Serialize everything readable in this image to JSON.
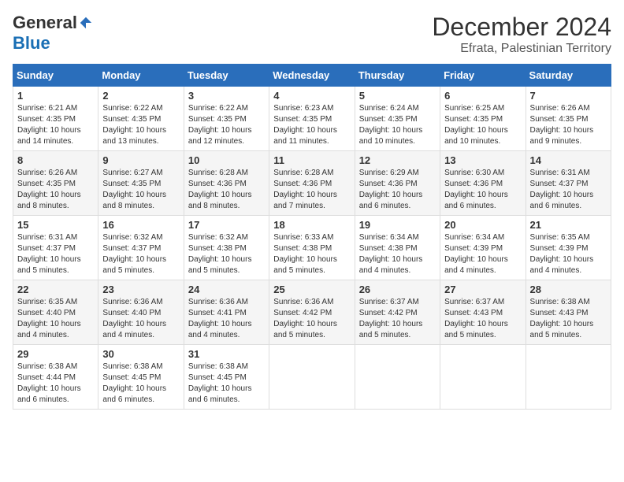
{
  "header": {
    "logo_general": "General",
    "logo_blue": "Blue",
    "month_title": "December 2024",
    "location": "Efrata, Palestinian Territory"
  },
  "weekdays": [
    "Sunday",
    "Monday",
    "Tuesday",
    "Wednesday",
    "Thursday",
    "Friday",
    "Saturday"
  ],
  "weeks": [
    [
      {
        "day": "1",
        "sunrise": "6:21 AM",
        "sunset": "4:35 PM",
        "daylight": "10 hours and 14 minutes."
      },
      {
        "day": "2",
        "sunrise": "6:22 AM",
        "sunset": "4:35 PM",
        "daylight": "10 hours and 13 minutes."
      },
      {
        "day": "3",
        "sunrise": "6:22 AM",
        "sunset": "4:35 PM",
        "daylight": "10 hours and 12 minutes."
      },
      {
        "day": "4",
        "sunrise": "6:23 AM",
        "sunset": "4:35 PM",
        "daylight": "10 hours and 11 minutes."
      },
      {
        "day": "5",
        "sunrise": "6:24 AM",
        "sunset": "4:35 PM",
        "daylight": "10 hours and 10 minutes."
      },
      {
        "day": "6",
        "sunrise": "6:25 AM",
        "sunset": "4:35 PM",
        "daylight": "10 hours and 10 minutes."
      },
      {
        "day": "7",
        "sunrise": "6:26 AM",
        "sunset": "4:35 PM",
        "daylight": "10 hours and 9 minutes."
      }
    ],
    [
      {
        "day": "8",
        "sunrise": "6:26 AM",
        "sunset": "4:35 PM",
        "daylight": "10 hours and 8 minutes."
      },
      {
        "day": "9",
        "sunrise": "6:27 AM",
        "sunset": "4:35 PM",
        "daylight": "10 hours and 8 minutes."
      },
      {
        "day": "10",
        "sunrise": "6:28 AM",
        "sunset": "4:36 PM",
        "daylight": "10 hours and 8 minutes."
      },
      {
        "day": "11",
        "sunrise": "6:28 AM",
        "sunset": "4:36 PM",
        "daylight": "10 hours and 7 minutes."
      },
      {
        "day": "12",
        "sunrise": "6:29 AM",
        "sunset": "4:36 PM",
        "daylight": "10 hours and 6 minutes."
      },
      {
        "day": "13",
        "sunrise": "6:30 AM",
        "sunset": "4:36 PM",
        "daylight": "10 hours and 6 minutes."
      },
      {
        "day": "14",
        "sunrise": "6:31 AM",
        "sunset": "4:37 PM",
        "daylight": "10 hours and 6 minutes."
      }
    ],
    [
      {
        "day": "15",
        "sunrise": "6:31 AM",
        "sunset": "4:37 PM",
        "daylight": "10 hours and 5 minutes."
      },
      {
        "day": "16",
        "sunrise": "6:32 AM",
        "sunset": "4:37 PM",
        "daylight": "10 hours and 5 minutes."
      },
      {
        "day": "17",
        "sunrise": "6:32 AM",
        "sunset": "4:38 PM",
        "daylight": "10 hours and 5 minutes."
      },
      {
        "day": "18",
        "sunrise": "6:33 AM",
        "sunset": "4:38 PM",
        "daylight": "10 hours and 5 minutes."
      },
      {
        "day": "19",
        "sunrise": "6:34 AM",
        "sunset": "4:38 PM",
        "daylight": "10 hours and 4 minutes."
      },
      {
        "day": "20",
        "sunrise": "6:34 AM",
        "sunset": "4:39 PM",
        "daylight": "10 hours and 4 minutes."
      },
      {
        "day": "21",
        "sunrise": "6:35 AM",
        "sunset": "4:39 PM",
        "daylight": "10 hours and 4 minutes."
      }
    ],
    [
      {
        "day": "22",
        "sunrise": "6:35 AM",
        "sunset": "4:40 PM",
        "daylight": "10 hours and 4 minutes."
      },
      {
        "day": "23",
        "sunrise": "6:36 AM",
        "sunset": "4:40 PM",
        "daylight": "10 hours and 4 minutes."
      },
      {
        "day": "24",
        "sunrise": "6:36 AM",
        "sunset": "4:41 PM",
        "daylight": "10 hours and 4 minutes."
      },
      {
        "day": "25",
        "sunrise": "6:36 AM",
        "sunset": "4:42 PM",
        "daylight": "10 hours and 5 minutes."
      },
      {
        "day": "26",
        "sunrise": "6:37 AM",
        "sunset": "4:42 PM",
        "daylight": "10 hours and 5 minutes."
      },
      {
        "day": "27",
        "sunrise": "6:37 AM",
        "sunset": "4:43 PM",
        "daylight": "10 hours and 5 minutes."
      },
      {
        "day": "28",
        "sunrise": "6:38 AM",
        "sunset": "4:43 PM",
        "daylight": "10 hours and 5 minutes."
      }
    ],
    [
      {
        "day": "29",
        "sunrise": "6:38 AM",
        "sunset": "4:44 PM",
        "daylight": "10 hours and 6 minutes."
      },
      {
        "day": "30",
        "sunrise": "6:38 AM",
        "sunset": "4:45 PM",
        "daylight": "10 hours and 6 minutes."
      },
      {
        "day": "31",
        "sunrise": "6:38 AM",
        "sunset": "4:45 PM",
        "daylight": "10 hours and 6 minutes."
      },
      null,
      null,
      null,
      null
    ]
  ]
}
